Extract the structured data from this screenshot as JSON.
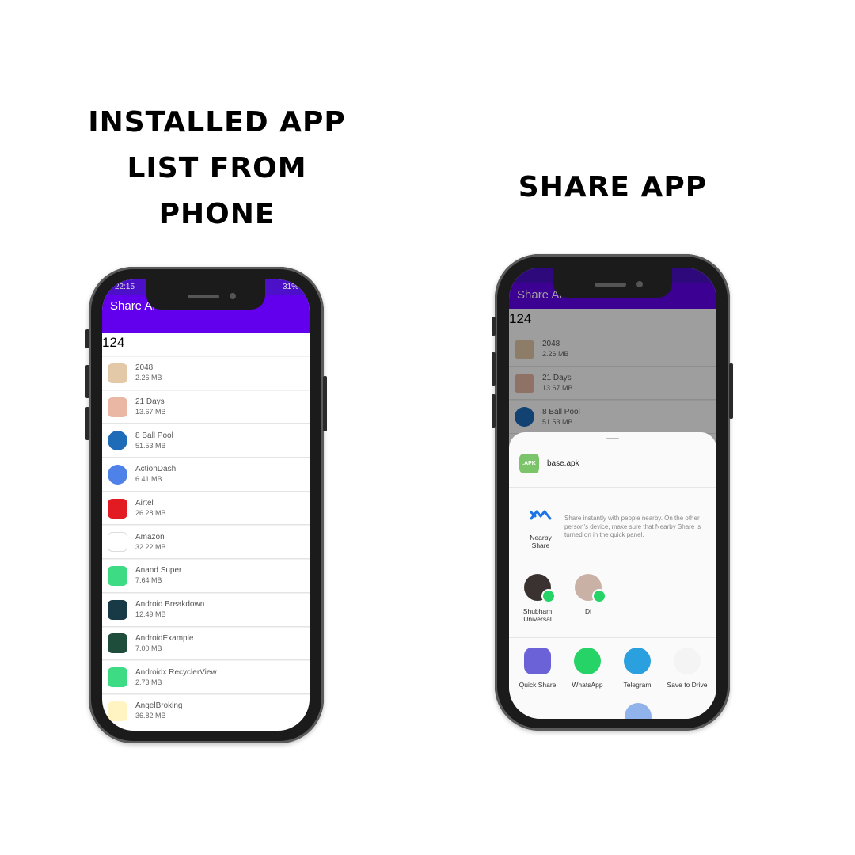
{
  "left_title": [
    "Installed App",
    "List from",
    "Phone"
  ],
  "right_title": "Share App",
  "phone1": {
    "time": "22:15",
    "battery": "31%",
    "app_title": "Share APK",
    "count": "124",
    "apps": [
      {
        "name": "2048",
        "size": "2.26 MB",
        "icon": "2048-icon",
        "color": "#e4c9a8"
      },
      {
        "name": "21 Days",
        "size": "13.67 MB",
        "icon": "21-days-icon",
        "color": "#e9b7a4"
      },
      {
        "name": "8 Ball Pool",
        "size": "51.53 MB",
        "icon": "8-ball-pool-icon",
        "color": "#1e6bb8"
      },
      {
        "name": "ActionDash",
        "size": "6.41 MB",
        "icon": "actiondash-icon",
        "color": "#4f82e8"
      },
      {
        "name": "Airtel",
        "size": "26.28 MB",
        "icon": "airtel-icon",
        "color": "#e21b22"
      },
      {
        "name": "Amazon",
        "size": "32.22 MB",
        "icon": "amazon-icon",
        "color": "#ffffff"
      },
      {
        "name": "Anand Super",
        "size": "7.64 MB",
        "icon": "android-icon",
        "color": "#3ddc84"
      },
      {
        "name": "Android Breakdown",
        "size": "12.49 MB",
        "icon": "android-breakdown-icon",
        "color": "#173a46"
      },
      {
        "name": "AndroidExample",
        "size": "7.00 MB",
        "icon": "android-example-icon",
        "color": "#1f4d3c"
      },
      {
        "name": "Androidx RecyclerView",
        "size": "2.73 MB",
        "icon": "android-icon",
        "color": "#3ddc84"
      },
      {
        "name": "AngelBroking",
        "size": "36.82 MB",
        "icon": "angelbroking-icon",
        "color": "#fff4c2"
      }
    ]
  },
  "phone2": {
    "app_title": "Share APK",
    "count": "124",
    "apps": [
      {
        "name": "2048",
        "size": "2.26 MB",
        "icon": "2048-icon",
        "color": "#e4c9a8"
      },
      {
        "name": "21 Days",
        "size": "13.67 MB",
        "icon": "21-days-icon",
        "color": "#e9b7a4"
      },
      {
        "name": "8 Ball Pool",
        "size": "51.53 MB",
        "icon": "8-ball-pool-icon",
        "color": "#1e6bb8"
      }
    ],
    "sheet": {
      "file_badge": ".APK",
      "file_name": "base.apk",
      "nearby_label": "Nearby Share",
      "nearby_text": "Share instantly with people nearby. On the other person's device, make sure that Nearby Share is turned on in the quick panel.",
      "contacts": [
        {
          "name": "Shubham Universal"
        },
        {
          "name": "Di"
        }
      ],
      "targets": [
        {
          "label": "Quick Share",
          "icon": "quick-share-icon",
          "color": "#6a62d6"
        },
        {
          "label": "WhatsApp",
          "icon": "whatsapp-icon",
          "color": "#25d366"
        },
        {
          "label": "Telegram",
          "icon": "telegram-icon",
          "color": "#2aa1de"
        },
        {
          "label": "Save to Drive",
          "icon": "google-drive-icon",
          "color": "#f4f4f4"
        }
      ]
    }
  }
}
